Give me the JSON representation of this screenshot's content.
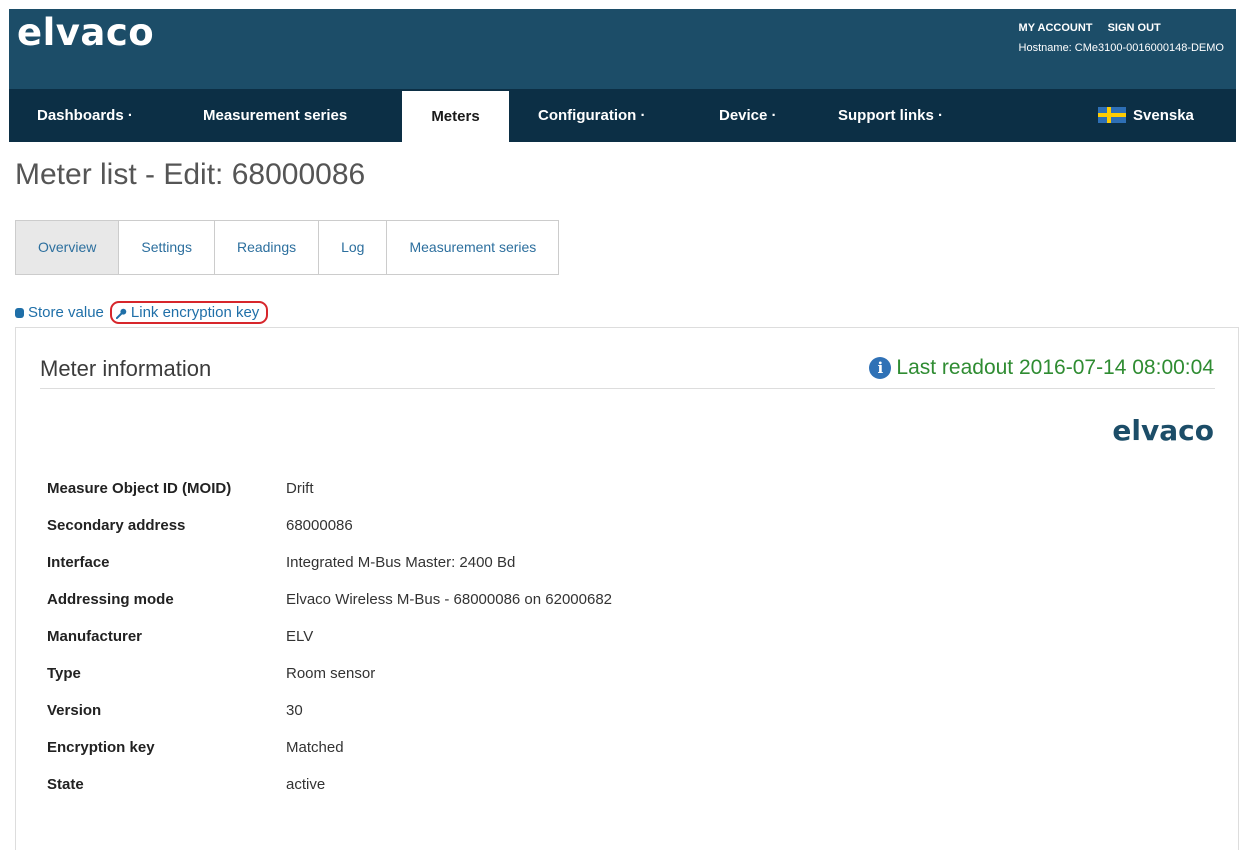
{
  "header": {
    "logo": "elvaco",
    "account_links": [
      "MY ACCOUNT",
      "SIGN OUT"
    ],
    "hostname": "Hostname: CMe3100-0016000148-DEMO"
  },
  "nav": {
    "items": [
      "Dashboards ·",
      "Measurement series",
      "Meters",
      "Configuration ·",
      "Device ·",
      "Support links ·"
    ],
    "active": "Meters",
    "language": "Svenska",
    "language_flag_icon": "sweden-flag-icon"
  },
  "page": {
    "title": "Meter list - Edit: 68000086"
  },
  "tabs": {
    "items": [
      "Overview",
      "Settings",
      "Readings",
      "Log",
      "Measurement series"
    ],
    "active": "Overview"
  },
  "actions": {
    "store_value": "Store value",
    "link_key": "Link encryption key",
    "highlight_color": "#d7262b"
  },
  "meter_info": {
    "title": "Meter information",
    "readout_label": "Last readout",
    "readout_value": "2016-07-14 08:00:04",
    "brand": "elvaco",
    "rows": [
      {
        "key": "Measure Object ID (MOID)",
        "value": "Drift"
      },
      {
        "key": "Secondary address",
        "value": "68000086"
      },
      {
        "key": "Interface",
        "value": "Integrated M-Bus Master: 2400 Bd"
      },
      {
        "key": "Addressing mode",
        "value": "Elvaco Wireless M-Bus - 68000086 on 62000682"
      },
      {
        "key": "Manufacturer",
        "value": "ELV"
      },
      {
        "key": "Type",
        "value": "Room sensor"
      },
      {
        "key": "Version",
        "value": "30"
      },
      {
        "key": "Encryption key",
        "value": "Matched"
      },
      {
        "key": "State",
        "value": "active"
      }
    ]
  },
  "colors": {
    "header_bg": "#1c4d68",
    "nav_bg": "#0c2f45",
    "link": "#1f6fa8",
    "readout_green": "#2f8c32"
  }
}
